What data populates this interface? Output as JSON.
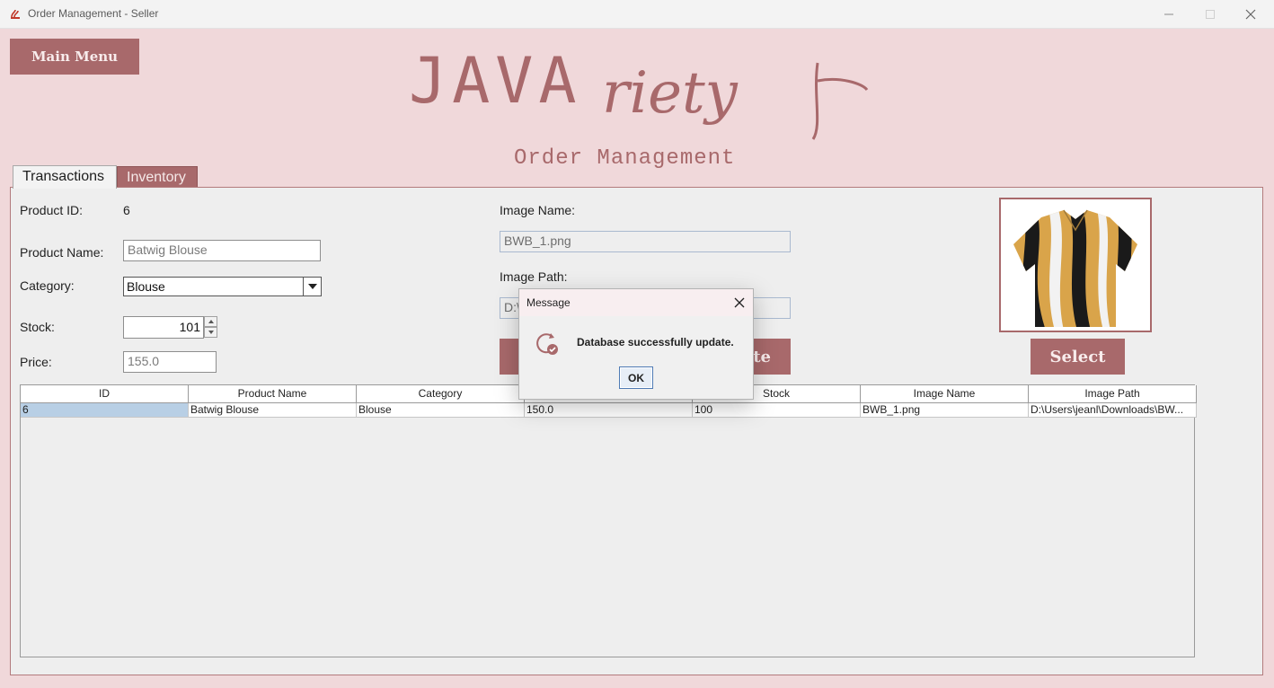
{
  "window": {
    "title": "Order Management - Seller",
    "icon": "app-icon"
  },
  "header": {
    "main_menu_label": "Main Menu",
    "logo_java": "JAVA",
    "logo_script": "riety",
    "subtitle": "Order Management"
  },
  "tabs": [
    {
      "label": "Transactions",
      "active": true
    },
    {
      "label": "Inventory",
      "active": false
    }
  ],
  "form": {
    "product_id_label": "Product ID:",
    "product_id_value": "6",
    "product_name_label": "Product Name:",
    "product_name_value": "Batwig Blouse",
    "category_label": "Category:",
    "category_value": "Blouse",
    "stock_label": "Stock:",
    "stock_value": "101",
    "price_label": "Price:",
    "price_value": "155.0",
    "image_name_label": "Image Name:",
    "image_name_value": "BWB_1.png",
    "image_path_label": "Image Path:",
    "image_path_value": "D:\\",
    "update_label": "te",
    "select_label": "Select"
  },
  "table": {
    "columns": [
      "ID",
      "Product Name",
      "Category",
      "",
      "Stock",
      "Image Name",
      "Image Path"
    ],
    "rows": [
      [
        "6",
        "Batwig Blouse",
        "Blouse",
        "150.0",
        "100",
        "BWB_1.png",
        "D:\\Users\\jeanl\\Downloads\\BW..."
      ]
    ]
  },
  "dialog": {
    "title": "Message",
    "message": "Database successfully update.",
    "ok_label": "OK"
  },
  "colors": {
    "accent": "#a8696b",
    "background": "#f0d8da",
    "panel": "#eeeeee"
  }
}
